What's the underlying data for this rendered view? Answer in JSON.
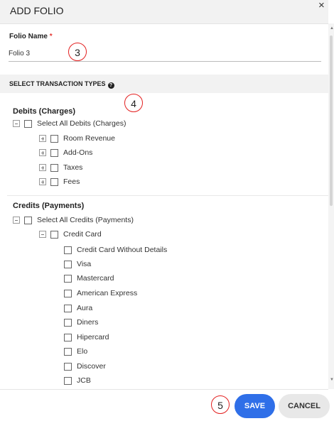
{
  "dialog": {
    "title": "ADD FOLIO",
    "close_glyph": "×"
  },
  "folio_name": {
    "label": "Folio Name",
    "required_mark": "*",
    "value": "Folio 3"
  },
  "section": {
    "label": "SELECT TRANSACTION TYPES",
    "help_icon": "?"
  },
  "annotations": [
    "3",
    "4",
    "5"
  ],
  "debits": {
    "title": "Debits (Charges)",
    "select_all": "Select All Debits (Charges)",
    "items": [
      "Room Revenue",
      "Add-Ons",
      "Taxes",
      "Fees"
    ]
  },
  "credits": {
    "title": "Credits (Payments)",
    "select_all": "Select All Credits (Payments)",
    "credit_card": {
      "label": "Credit Card",
      "items": [
        "Credit Card Without Details",
        "Visa",
        "Mastercard",
        "American Express",
        "Aura",
        "Diners",
        "Hipercard",
        "Elo",
        "Discover",
        "JCB"
      ]
    }
  },
  "buttons": {
    "save": "SAVE",
    "cancel": "CANCEL"
  },
  "colors": {
    "primary": "#2f6fe8",
    "annotation": "#e32020",
    "required": "#e53935"
  }
}
